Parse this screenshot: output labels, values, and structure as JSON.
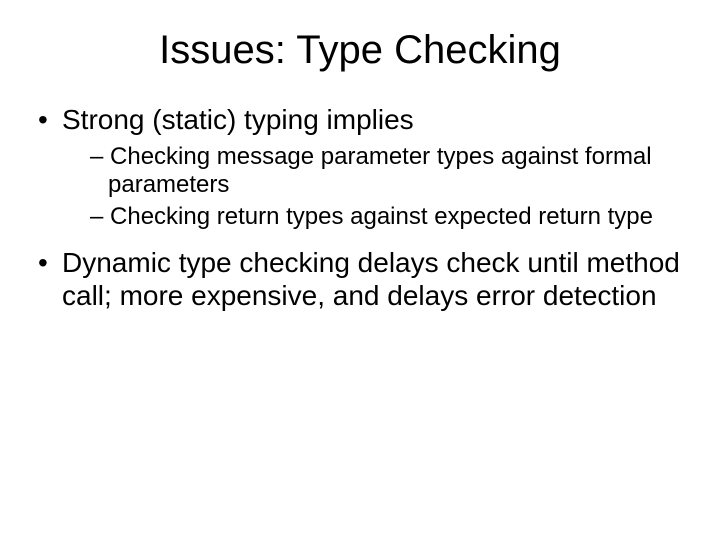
{
  "title": "Issues: Type Checking",
  "bullets": [
    {
      "text": "Strong (static) typing implies",
      "sub": [
        "Checking message parameter types against formal parameters",
        "Checking return types against expected return type"
      ]
    },
    {
      "text": "Dynamic type checking delays check until method call; more expensive, and delays error detection",
      "sub": []
    }
  ]
}
